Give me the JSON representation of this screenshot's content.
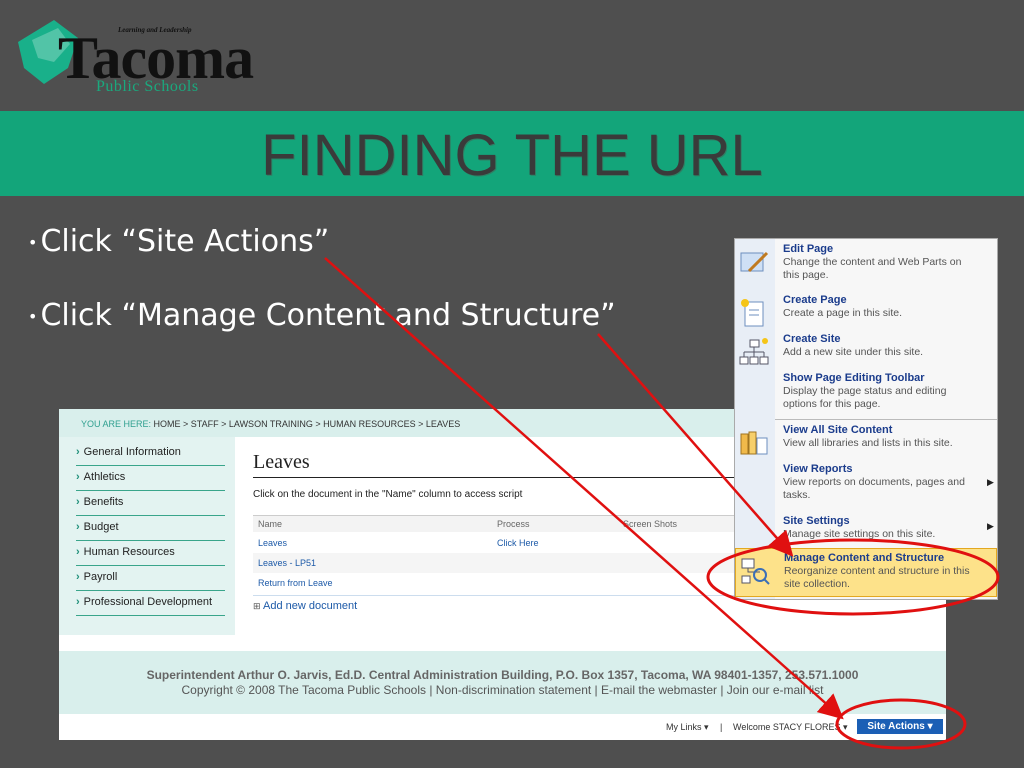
{
  "logo": {
    "tagline": "Learning and Leadership",
    "wordmark": "Tacoma",
    "subtitle": "Public Schools",
    "icon": "apple-shape-logo"
  },
  "slide": {
    "title": "FINDING THE URL",
    "bullets": [
      "Click “Site Actions”",
      "Click “Manage Content and Structure”"
    ]
  },
  "sharepoint": {
    "breadcrumb_prefix": "YOU ARE HERE:",
    "breadcrumb": "HOME > STAFF > LAWSON TRAINING > HUMAN RESOURCES > LEAVES",
    "nav_items": [
      "General Information",
      "Athletics",
      "Benefits",
      "Budget",
      "Human Resources",
      "Payroll",
      "Professional Development"
    ],
    "page_title": "Leaves",
    "instruction": "Click on the document in the \"Name\" column to access script",
    "columns": [
      "Name",
      "Process",
      "Screen Shots"
    ],
    "rows": [
      {
        "name": "Leaves",
        "process": "Click Here"
      },
      {
        "name": "Leaves - LP51",
        "process": ""
      },
      {
        "name": "Return from Leave",
        "process": ""
      }
    ],
    "add_new": "Add new document",
    "footer_line1": "Superintendent Arthur O. Jarvis, Ed.D. Central Administration Building, P.O. Box 1357, Tacoma, WA 98401-1357, 253.571.1000",
    "footer_line2": "Copyright © 2008 The Tacoma Public Schools | Non-discrimination statement | E-mail the webmaster | Join our e-mail list",
    "my_links": "My Links ▾",
    "separator": "|",
    "welcome": "Welcome STACY FLORES ▾",
    "site_actions": "Site Actions ▾"
  },
  "menu": {
    "items": [
      {
        "title": "Edit Page",
        "desc": "Change the content and Web Parts on this page.",
        "icon": "edit-page-icon"
      },
      {
        "title": "Create Page",
        "desc": "Create a page in this site.",
        "icon": "create-page-icon"
      },
      {
        "title": "Create Site",
        "desc": "Add a new site under this site.",
        "icon": "create-site-icon"
      },
      {
        "title": "Show Page Editing Toolbar",
        "desc": "Display the page status and editing options for this page.",
        "icon": ""
      },
      {
        "title": "View All Site Content",
        "desc": "View all libraries and lists in this site.",
        "icon": "library-icon"
      },
      {
        "title": "View Reports",
        "desc": "View reports on documents, pages and tasks.",
        "icon": ""
      },
      {
        "title": "Site Settings",
        "desc": "Manage site settings on this site.",
        "icon": ""
      },
      {
        "title": "Manage Content and Structure",
        "desc": "Reorganize content and structure in this site collection.",
        "icon": "site-structure-icon"
      }
    ]
  },
  "colors": {
    "background": "#4f4f4f",
    "title_band": "#13a57a",
    "annotation": "#e01010",
    "highlight": "#fde28a",
    "site_actions_button": "#1b5fb5"
  }
}
